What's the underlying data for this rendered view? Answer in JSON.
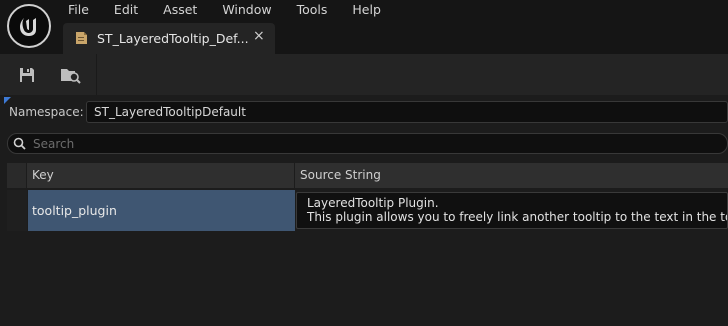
{
  "menu": {
    "items": [
      "File",
      "Edit",
      "Asset",
      "Window",
      "Tools",
      "Help"
    ]
  },
  "tab": {
    "label": "ST_LayeredTooltip_Def...",
    "close": "×"
  },
  "toolbar": {
    "buttons": [
      "save-icon",
      "browse-icon"
    ]
  },
  "namespace": {
    "label": "Namespace:",
    "value": "ST_LayeredTooltipDefault"
  },
  "search": {
    "placeholder": "Search"
  },
  "table": {
    "columns": {
      "key": "Key",
      "source": "Source String"
    },
    "rows": [
      {
        "key": "tooltip_plugin",
        "source_line1": "LayeredTooltip Plugin.",
        "source_line2": "This plugin allows you to freely link another tooltip to the text in the tooltip."
      }
    ]
  },
  "colors": {
    "accent": "#3d7ad6",
    "selected_row": "#3f5672"
  }
}
